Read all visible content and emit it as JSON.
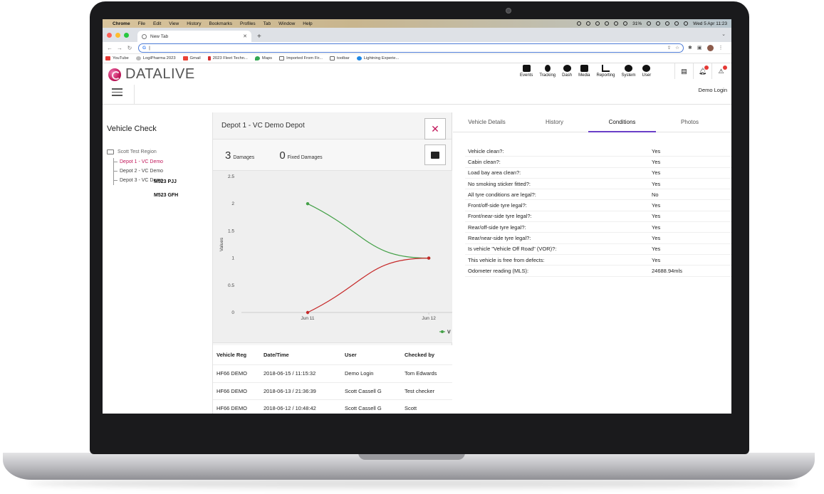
{
  "mac_menu": {
    "app": "Chrome",
    "items": [
      "File",
      "Edit",
      "View",
      "History",
      "Bookmarks",
      "Profiles",
      "Tab",
      "Window",
      "Help"
    ],
    "battery": "31%",
    "clock": "Wed 5 Apr  11:23"
  },
  "browser": {
    "tab_title": "New Tab",
    "new_tab_symbol": "+",
    "url_prefix": "G",
    "bookmarks": [
      "YouTube",
      "LogiPharma 2023",
      "Gmail",
      "2023 Fleet Techn...",
      "Maps",
      "Imported From Fir...",
      "toolbar",
      "Lightning Experie..."
    ]
  },
  "app": {
    "logo": "DATALIVE",
    "nav": [
      "Events",
      "Tracking",
      "Dash",
      "Media",
      "Reporting",
      "System",
      "User"
    ],
    "login_label": "Demo Login"
  },
  "left": {
    "title": "Vehicle Check",
    "region": "Scott Test Region",
    "depots": [
      "Depot 1 - VC Demo",
      "Depot 2 - VC Demo",
      "Depot 3 - VC Demo"
    ],
    "floating_regs": [
      "M523  PJJ",
      "M523 GFH"
    ]
  },
  "middle": {
    "header": "Depot 1 - VC Demo Depot",
    "damages_count": "3",
    "damages_label": "Damages",
    "fixed_count": "0",
    "fixed_label": "Fixed Damages",
    "close_symbol": "✕",
    "table": {
      "headers": [
        "Vehicle Reg",
        "Date/Time",
        "User",
        "Checked by"
      ],
      "rows": [
        [
          "HF66 DEMO",
          "2018-06-15 / 11:15:32",
          "Demo Login",
          "Tom Edwards"
        ],
        [
          "HF66 DEMO",
          "2018-06-13 / 21:36:39",
          "Scott Cassell G",
          "Test checker"
        ],
        [
          "HF66 DEMO",
          "2018-06-12 / 10:48:42",
          "Scott Cassell G",
          "Scott"
        ]
      ]
    }
  },
  "chart_data": {
    "type": "line",
    "x": [
      "Jun 11",
      "Jun 12"
    ],
    "series": [
      {
        "values": [
          2,
          1
        ],
        "color": "#43a047"
      },
      {
        "values": [
          0,
          1
        ],
        "color": "#c62828"
      }
    ],
    "ylabel": "Values",
    "yticks": [
      "0",
      "0.5",
      "1",
      "1.5",
      "2",
      "2.5"
    ],
    "ylim": [
      0,
      2.5
    ],
    "legend_partial": "V",
    "grid": false
  },
  "right": {
    "tabs": [
      "Vehicle Details",
      "History",
      "Conditions",
      "Photos"
    ],
    "active_tab": "Conditions",
    "conditions": [
      [
        "Vehicle clean?:",
        "Yes"
      ],
      [
        "Cabin clean?:",
        "Yes"
      ],
      [
        "Load bay area clean?:",
        "Yes"
      ],
      [
        "No smoking sticker fitted?:",
        "Yes"
      ],
      [
        "All tyre conditions are legal?:",
        "No"
      ],
      [
        "Front/off-side tyre legal?:",
        "Yes"
      ],
      [
        "Front/near-side tyre legal?:",
        "Yes"
      ],
      [
        "Rear/off-side tyre legal?:",
        "Yes"
      ],
      [
        "Rear/near-side tyre legal?:",
        "Yes"
      ],
      [
        "Is vehicle \"Vehicle Off Road\" (VOR)?:",
        "Yes"
      ],
      [
        "This vehicle is free from defects:",
        "Yes"
      ],
      [
        "Odometer reading (MLS):",
        "24688.94mls"
      ]
    ]
  },
  "colors": {
    "brand": "#c2185b",
    "tab_accent": "#6a3fc7"
  }
}
